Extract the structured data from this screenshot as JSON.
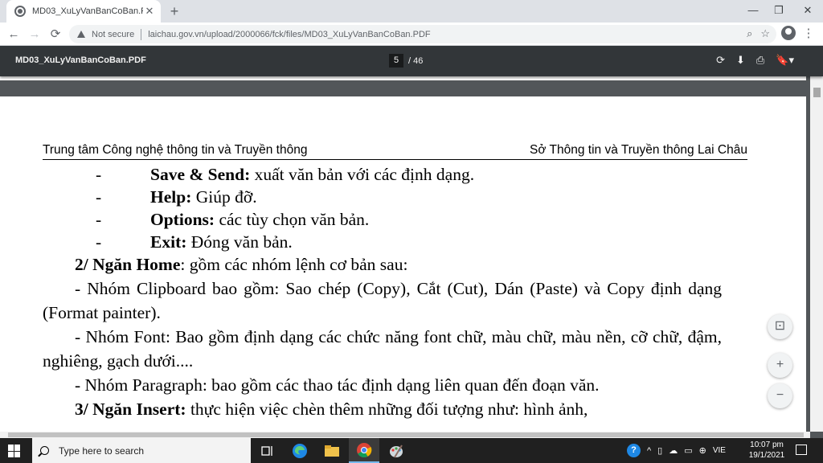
{
  "browser": {
    "tab_title": "MD03_XuLyVanBanCoBan.PDF",
    "tab_close": "✕",
    "new_tab": "+",
    "window_controls": {
      "minimize": "—",
      "restore": "❐",
      "close": "✕"
    },
    "nav": {
      "back": "←",
      "forward": "→",
      "reload": "⟳"
    },
    "security_label": "Not secure",
    "url": "laichau.gov.vn/upload/2000066/fck/files/MD03_XuLyVanBanCoBan.PDF",
    "zoom_icon": "⌕",
    "bookmark_icon": "☆",
    "menu_icon": "⋮"
  },
  "pdf_viewer": {
    "filename": "MD03_XuLyVanBanCoBan.PDF",
    "current_page": "5",
    "total_pages": "/ 46",
    "actions": {
      "rotate": "⟳",
      "download": "⬇",
      "print": "⎙",
      "bookmark": "🔖▾"
    },
    "zoom": {
      "fit": "⊡",
      "zoom_in": "+",
      "zoom_out": "−"
    }
  },
  "document": {
    "header_left": "Trung tâm Công nghệ thông tin và Truyền thông",
    "header_right": "Sở Thông tin và Truyền thông Lai Châu",
    "bullets": [
      {
        "dash": "-",
        "term": "Save & Send:",
        "desc": " xuất văn bản với các định dạng."
      },
      {
        "dash": "-",
        "term": "Help:",
        "desc": " Giúp đỡ."
      },
      {
        "dash": "-",
        "term": "Options:",
        "desc": " các tùy chọn văn bản."
      },
      {
        "dash": "-",
        "term": "Exit:",
        "desc": " Đóng văn bản."
      }
    ],
    "section2_title": "2/ Ngăn Home",
    "section2_desc": ": gồm các nhóm lệnh cơ bản sau:",
    "para_clipboard": "- Nhóm Clipboard bao gồm: Sao chép (Copy), Cắt (Cut), Dán (Paste) và Copy định dạng (Format painter).",
    "para_font": "- Nhóm Font: Bao gồm định dạng các chức năng font chữ, màu chữ, màu nền, cỡ chữ, đậm, nghiêng, gạch dưới....",
    "para_paragraph": "- Nhóm Paragraph: bao gồm các thao tác định dạng liên quan đến đoạn văn.",
    "section3_title": "3/ Ngăn Insert:",
    "section3_desc": " thực hiện việc chèn thêm những đối tượng như: hình ảnh,"
  },
  "taskbar": {
    "search_placeholder": "Type here to search",
    "tray_language": "VIE",
    "clock_time": "10:07 pm",
    "clock_date": "19/1/2021"
  }
}
